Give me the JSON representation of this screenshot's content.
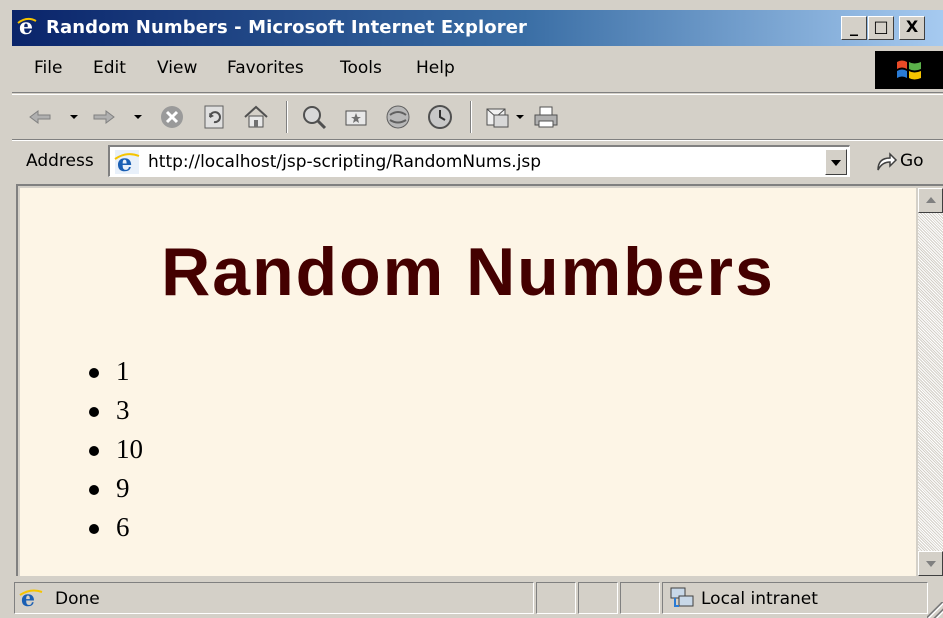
{
  "window": {
    "title": "Random Numbers - Microsoft Internet Explorer",
    "controls": {
      "minimize": "_",
      "maximize": "□",
      "close": "X"
    }
  },
  "menu": {
    "items": [
      "File",
      "Edit",
      "View",
      "Favorites",
      "Tools",
      "Help"
    ]
  },
  "toolbar": {
    "icons": [
      "back-icon",
      "forward-icon",
      "stop-icon",
      "refresh-icon",
      "home-icon",
      "search-icon",
      "favorites-icon",
      "media-icon",
      "history-icon",
      "mail-icon",
      "print-icon"
    ]
  },
  "address": {
    "label": "Address",
    "url": "http://localhost/jsp-scripting/RandomNums.jsp",
    "go_label": "Go"
  },
  "page": {
    "heading": "Random Numbers",
    "numbers": [
      "1",
      "3",
      "10",
      "9",
      "6"
    ],
    "heading_color": "#440000",
    "background_color": "#fdf5e6"
  },
  "status": {
    "text": "Done",
    "zone": "Local intranet"
  }
}
